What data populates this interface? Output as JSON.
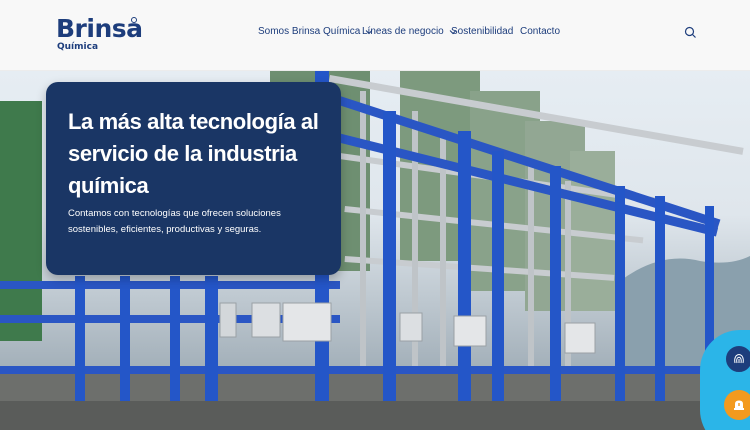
{
  "brand": {
    "name": "Brinsa",
    "subtitle": "Química",
    "color": "#1d3d7c"
  },
  "nav": {
    "items": [
      {
        "label": "Somos Brinsa Química",
        "has_dropdown": true
      },
      {
        "label": "Líneas de negocio",
        "has_dropdown": true
      },
      {
        "label": "Sostenibilidad",
        "has_dropdown": false
      },
      {
        "label": "Contacto",
        "has_dropdown": false
      }
    ],
    "search_icon": "search-icon"
  },
  "hero": {
    "title": "La más alta tecnología al servicio de la industria química",
    "description": "Contamos con tecnologías que ofrecen soluciones sostenibles, eficientes, productivas y seguras.",
    "card_color": "#1a3665"
  },
  "floating": {
    "fingerprint_icon": "fingerprint-icon",
    "alert_icon": "alarm-icon",
    "accent": "#2bb5e8",
    "alert_color": "#f39a1e"
  }
}
